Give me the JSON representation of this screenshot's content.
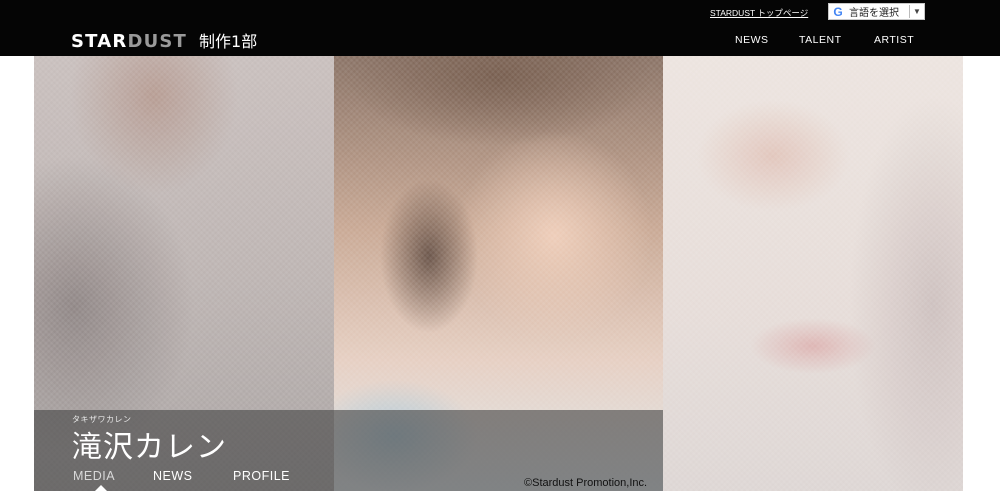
{
  "header": {
    "logo_star": "STAR",
    "logo_dust": "DUST",
    "logo_division": "制作1部",
    "top_link": "STARDUST トップページ",
    "lang_select": {
      "icon": "google-g-icon",
      "label": "言語を選択",
      "arrow": "▼"
    },
    "nav": [
      {
        "label": "NEWS"
      },
      {
        "label": "TALENT"
      },
      {
        "label": "ARTIST"
      }
    ]
  },
  "profile": {
    "name_ruby": "タキザワカレン",
    "name": "滝沢カレン",
    "tabs": [
      {
        "label": "MEDIA",
        "active": true
      },
      {
        "label": "NEWS",
        "active": false
      },
      {
        "label": "PROFILE",
        "active": false
      }
    ],
    "copyright": "©Stardust Promotion,Inc."
  },
  "colors": {
    "header_bg": "#050505",
    "name_bar_bg": "rgba(70,70,70,0.62)"
  }
}
